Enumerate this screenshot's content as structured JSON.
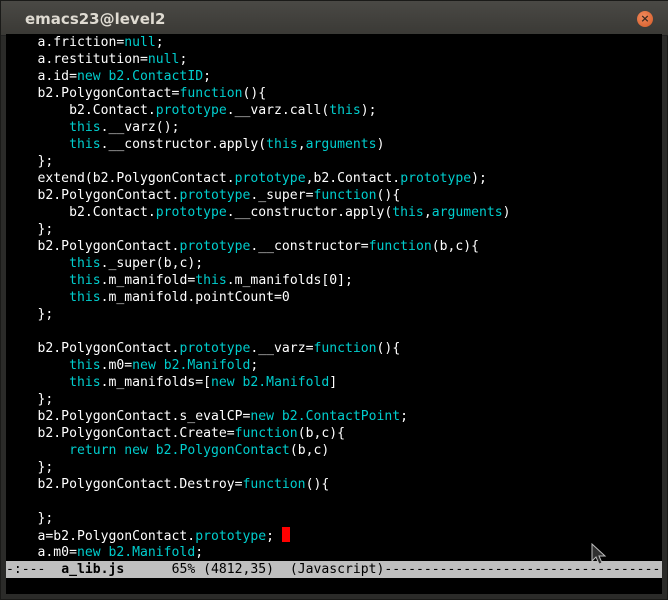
{
  "window": {
    "title": "emacs23@level2",
    "close_glyph": "×"
  },
  "editor": {
    "lines": [
      [
        {
          "t": "    a.friction="
        },
        {
          "t": "null",
          "k": 1
        },
        {
          "t": ";"
        }
      ],
      [
        {
          "t": "    a.restitution="
        },
        {
          "t": "null",
          "k": 1
        },
        {
          "t": ";"
        }
      ],
      [
        {
          "t": "    a.id="
        },
        {
          "t": "new b2.ContactID",
          "k": 1
        },
        {
          "t": ";"
        }
      ],
      [
        {
          "t": "    b2.PolygonContact="
        },
        {
          "t": "function",
          "k": 1
        },
        {
          "t": "(){"
        }
      ],
      [
        {
          "t": "        b2.Contact."
        },
        {
          "t": "prototype",
          "k": 1
        },
        {
          "t": ".__varz.call("
        },
        {
          "t": "this",
          "k": 1
        },
        {
          "t": ");"
        }
      ],
      [
        {
          "t": "        "
        },
        {
          "t": "this",
          "k": 1
        },
        {
          "t": ".__varz();"
        }
      ],
      [
        {
          "t": "        "
        },
        {
          "t": "this",
          "k": 1
        },
        {
          "t": ".__constructor.apply("
        },
        {
          "t": "this",
          "k": 1
        },
        {
          "t": ","
        },
        {
          "t": "arguments",
          "k": 1
        },
        {
          "t": ")"
        }
      ],
      [
        {
          "t": "    };"
        }
      ],
      [
        {
          "t": "    extend(b2.PolygonContact."
        },
        {
          "t": "prototype",
          "k": 1
        },
        {
          "t": ",b2.Contact."
        },
        {
          "t": "prototype",
          "k": 1
        },
        {
          "t": ");"
        }
      ],
      [
        {
          "t": "    b2.PolygonContact."
        },
        {
          "t": "prototype",
          "k": 1
        },
        {
          "t": "._super="
        },
        {
          "t": "function",
          "k": 1
        },
        {
          "t": "(){"
        }
      ],
      [
        {
          "t": "        b2.Contact."
        },
        {
          "t": "prototype",
          "k": 1
        },
        {
          "t": ".__constructor.apply("
        },
        {
          "t": "this",
          "k": 1
        },
        {
          "t": ","
        },
        {
          "t": "arguments",
          "k": 1
        },
        {
          "t": ")"
        }
      ],
      [
        {
          "t": "    };"
        }
      ],
      [
        {
          "t": "    b2.PolygonContact."
        },
        {
          "t": "prototype",
          "k": 1
        },
        {
          "t": ".__constructor="
        },
        {
          "t": "function",
          "k": 1
        },
        {
          "t": "(b,c){"
        }
      ],
      [
        {
          "t": "        "
        },
        {
          "t": "this",
          "k": 1
        },
        {
          "t": "._super(b,c);"
        }
      ],
      [
        {
          "t": "        "
        },
        {
          "t": "this",
          "k": 1
        },
        {
          "t": ".m_manifold="
        },
        {
          "t": "this",
          "k": 1
        },
        {
          "t": ".m_manifolds[0];"
        }
      ],
      [
        {
          "t": "        "
        },
        {
          "t": "this",
          "k": 1
        },
        {
          "t": ".m_manifold.pointCount=0"
        }
      ],
      [
        {
          "t": "    };"
        }
      ],
      [
        {
          "t": ""
        }
      ],
      [
        {
          "t": "    b2.PolygonContact."
        },
        {
          "t": "prototype",
          "k": 1
        },
        {
          "t": ".__varz="
        },
        {
          "t": "function",
          "k": 1
        },
        {
          "t": "(){"
        }
      ],
      [
        {
          "t": "        "
        },
        {
          "t": "this",
          "k": 1
        },
        {
          "t": ".m0="
        },
        {
          "t": "new b2.Manifold",
          "k": 1
        },
        {
          "t": ";"
        }
      ],
      [
        {
          "t": "        "
        },
        {
          "t": "this",
          "k": 1
        },
        {
          "t": ".m_manifolds=["
        },
        {
          "t": "new b2.Manifold",
          "k": 1
        },
        {
          "t": "]"
        }
      ],
      [
        {
          "t": "    };"
        }
      ],
      [
        {
          "t": "    b2.PolygonContact.s_evalCP="
        },
        {
          "t": "new b2.ContactPoint",
          "k": 1
        },
        {
          "t": ";"
        }
      ],
      [
        {
          "t": "    b2.PolygonContact.Create="
        },
        {
          "t": "function",
          "k": 1
        },
        {
          "t": "(b,c){"
        }
      ],
      [
        {
          "t": "        "
        },
        {
          "t": "return new b2.PolygonContact",
          "k": 1
        },
        {
          "t": "(b,c)"
        }
      ],
      [
        {
          "t": "    };"
        }
      ],
      [
        {
          "t": "    b2.PolygonContact.Destroy="
        },
        {
          "t": "function",
          "k": 1
        },
        {
          "t": "(){"
        }
      ],
      [
        {
          "t": ""
        }
      ],
      [
        {
          "t": "    };"
        }
      ],
      [
        {
          "t": "    a=b2.PolygonContact."
        },
        {
          "t": "prototype",
          "k": 1
        },
        {
          "t": "; "
        },
        {
          "c": 1
        }
      ],
      [
        {
          "t": "    a.m0="
        },
        {
          "t": "new b2.Manifold",
          "k": 1
        },
        {
          "t": ";"
        }
      ]
    ]
  },
  "modeline": {
    "status": "-:---  ",
    "buffer": "a_lib.js",
    "position": "      65% (4812,35)  ",
    "mode": "(Javascript)",
    "fill": "-------------------------------------"
  },
  "colors": {
    "keyword": "#00cdcd",
    "text": "#ffffff",
    "cursor": "#ff0000",
    "modeline_bg": "#bfbfbf",
    "titlebar": "#3c3b37",
    "close_button": "#e2622a"
  },
  "icons": {
    "close": "close-icon",
    "pointer": "mouse-pointer-icon"
  }
}
